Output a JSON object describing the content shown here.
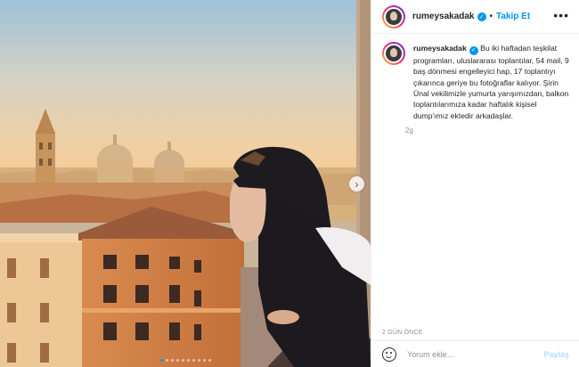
{
  "post": {
    "username": "rumeysakadak",
    "follow_label": "Takip Et",
    "separator": "•",
    "caption": "Bu iki haftadan teşkilat programları, uluslararası toplantılar, 54 mail, 9 baş dönmesi engelleyici hap, 17 toplantıyı çıkarınca geriye bu fotoğraflar kalıyor. Şirin Ünal vekilimizle yumurta yarışımızdan, balkon toplantılarımıza kadar haftalık kişisel dump'ımız ektedir arkadaşlar.",
    "caption_time": "2g",
    "date": "2 GÜN ÖNCE"
  },
  "comment": {
    "placeholder": "Yorum ekle...",
    "share_label": "Paylaş"
  },
  "icons": {
    "verified": "verified-badge-icon",
    "more": "more-options-icon",
    "emoji": "emoji-icon",
    "next": "chevron-right-icon"
  },
  "carousel": {
    "slides": 10,
    "active_index": 0
  },
  "colors": {
    "accent": "#0095f6",
    "share_disabled": "#b2dffc",
    "muted": "#8e8e8e"
  }
}
